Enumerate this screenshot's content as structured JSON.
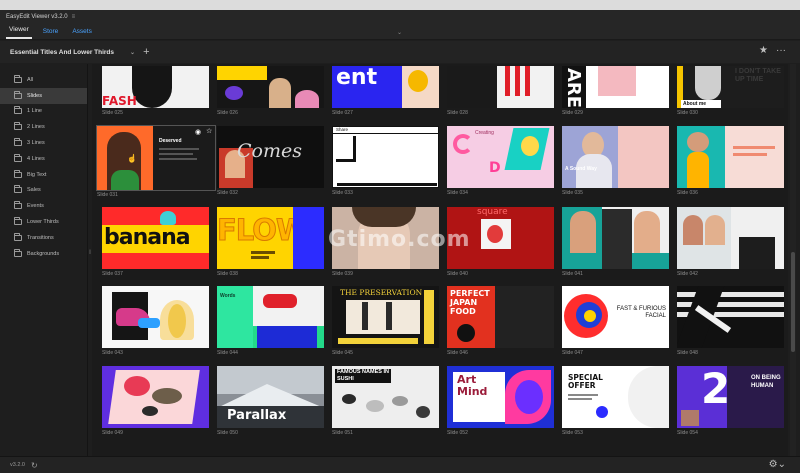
{
  "window": {
    "title": "EasyEdit Viewer v3.2.0"
  },
  "tabs": [
    {
      "label": "Viewer",
      "active": true
    },
    {
      "label": "Store",
      "active": false
    },
    {
      "label": "Assets",
      "active": false
    }
  ],
  "toolbar": {
    "collection": "Essential Titles And Lower Thirds"
  },
  "sidebar": {
    "items": [
      {
        "label": "All"
      },
      {
        "label": "Slides",
        "active": true
      },
      {
        "label": "1 Line"
      },
      {
        "label": "2 Lines"
      },
      {
        "label": "3 Lines"
      },
      {
        "label": "4 Lines"
      },
      {
        "label": "Big Text"
      },
      {
        "label": "Sales"
      },
      {
        "label": "Events"
      },
      {
        "label": "Lower Thirds"
      },
      {
        "label": "Transitions"
      },
      {
        "label": "Backgrounds"
      }
    ]
  },
  "slides": [
    {
      "label": "Slide 025",
      "text": "FASH"
    },
    {
      "label": "Slide 026",
      "text": ""
    },
    {
      "label": "Slide 027",
      "text": "ent"
    },
    {
      "label": "Slide 028",
      "text": ""
    },
    {
      "label": "Slide 029",
      "text": "ARE"
    },
    {
      "label": "Slide 030",
      "text": "About me",
      "text2": "I DON'T TAKE UP TIME"
    },
    {
      "label": "Slide 031",
      "text": "Deserved"
    },
    {
      "label": "Slide 032",
      "text": "Comes"
    },
    {
      "label": "Slide 033",
      "text": "Share"
    },
    {
      "label": "Slide 034",
      "text": "Creating",
      "text2": "D"
    },
    {
      "label": "Slide 035",
      "text": "A Sound Way"
    },
    {
      "label": "Slide 036",
      "text": ""
    },
    {
      "label": "Slide 037",
      "text": "banana"
    },
    {
      "label": "Slide 038",
      "text": "FLOW"
    },
    {
      "label": "Slide 039",
      "text": ""
    },
    {
      "label": "Slide 040",
      "text": "square"
    },
    {
      "label": "Slide 041",
      "text": ""
    },
    {
      "label": "Slide 042",
      "text": ""
    },
    {
      "label": "Slide 043",
      "text": ""
    },
    {
      "label": "Slide 044",
      "text": "Words"
    },
    {
      "label": "Slide 045",
      "text": "THE PRESERVATION"
    },
    {
      "label": "Slide 046",
      "text": "PERFECT JAPAN FOOD"
    },
    {
      "label": "Slide 047",
      "text": "FAST & FURIOUS FACIAL"
    },
    {
      "label": "Slide 048",
      "text": ""
    },
    {
      "label": "Slide 049",
      "text": ""
    },
    {
      "label": "Slide 050",
      "text": "Parallax"
    },
    {
      "label": "Slide 051",
      "text": "FAMOUS NAMES IN SUSHI"
    },
    {
      "label": "Slide 052",
      "text": "Art Mind"
    },
    {
      "label": "Slide 053",
      "text": "SPECIAL OFFER"
    },
    {
      "label": "Slide 054",
      "text": "ON BEING HUMAN",
      "text2": "2"
    }
  ],
  "watermark": "Gtimo.com",
  "status": {
    "version": "v3.2.0"
  },
  "colors": {
    "accent": "#4aa3ff",
    "background": "#1e1e1e",
    "active_item": "#3a3a3a"
  }
}
